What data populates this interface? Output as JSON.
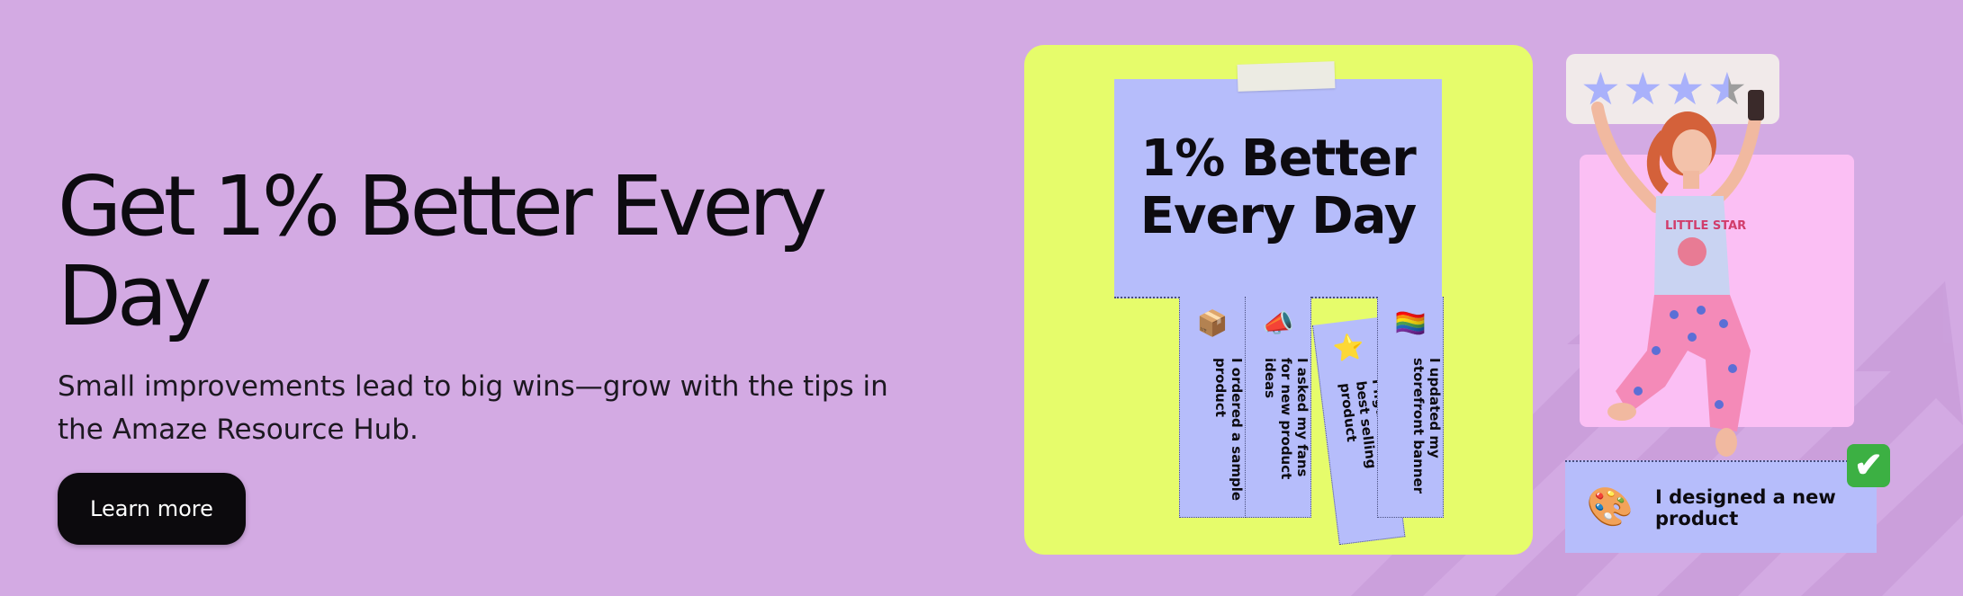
{
  "hero": {
    "headline": "Get 1% Better Every Day",
    "subtext": "Small improvements lead to big wins—grow with the tips in the Amaze Resource Hub.",
    "cta_label": "Learn more"
  },
  "flyer": {
    "title": "1% Better Every Day",
    "tabs": [
      {
        "icon": "box-icon",
        "glyph": "📦",
        "text": "I ordered a sample product"
      },
      {
        "icon": "megaphone-icon",
        "glyph": "📣",
        "text": "I asked my fans for new product ideas"
      },
      {
        "icon": "star-icon",
        "glyph": "⭐",
        "text": "I figured out my best selling product"
      },
      {
        "icon": "rainbow-flag-icon",
        "glyph": "🏳️‍🌈",
        "text": "I updated my storefront banner"
      }
    ]
  },
  "rating": {
    "stars": 3.5,
    "max": 4
  },
  "card": {
    "icon": "palette-icon",
    "glyph": "🎨",
    "text": "I designed a new product",
    "check_glyph": "✔"
  },
  "colors": {
    "background": "#d3aae3",
    "board": "#e6fc6b",
    "flyer": "#b6bdfb",
    "pink_panel": "#fbbff4",
    "button": "#0c0a0d"
  }
}
